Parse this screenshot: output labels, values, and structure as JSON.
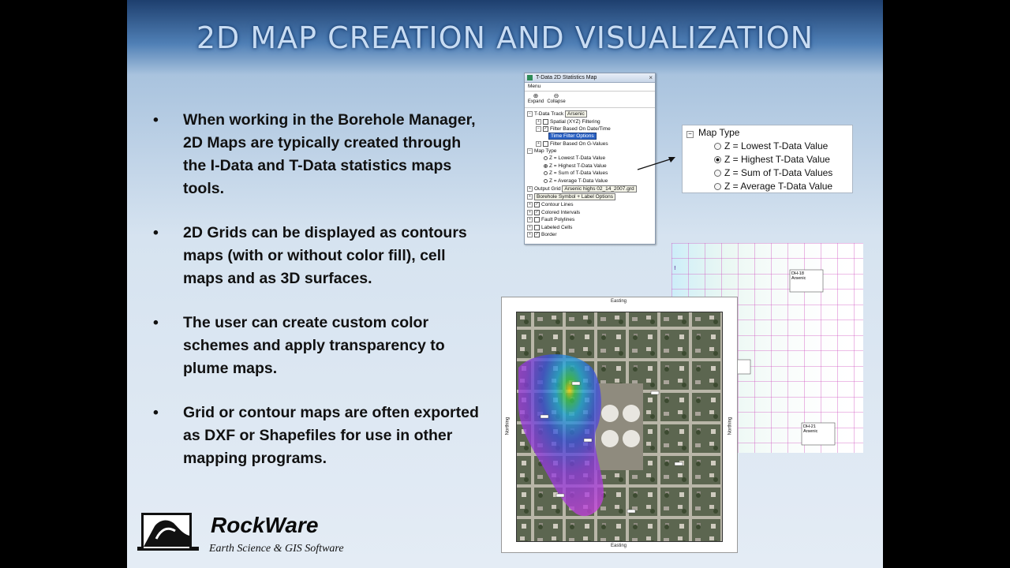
{
  "slide": {
    "title": "2D MAP CREATION AND VISUALIZATION",
    "bullet_char": "•",
    "bullets": [
      "When working in the Borehole Manager, 2D Maps are typically created through the I-Data and T-Data statistics maps tools.",
      "2D Grids can be displayed as contours maps (with or without color fill), cell maps and as 3D surfaces.",
      "The user can create custom color schemes and apply transparency to plume maps.",
      "Grid or contour maps are often exported as DXF or Shapefiles for use in other  mapping programs."
    ]
  },
  "dialog": {
    "title": "T-Data 2D Statistics Map",
    "menu": "Menu",
    "expand": "Expand",
    "collapse": "Collapse",
    "tdata_track": "T-Data Track",
    "tdata_track_value": "Arsenic",
    "spatial_filtering": "Spatial (XYZ) Filtering",
    "filter_date": "Filter Based On Date/Time",
    "time_filter_options": "Time Filter Options",
    "filter_gvalues": "Filter Based On G-Values",
    "map_type": "Map Type",
    "z_lowest": "Z = Lowest T-Data Value",
    "z_highest": "Z = Highest T-Data Value",
    "z_sum": "Z = Sum of T-Data Values",
    "z_average": "Z = Average T-Data Value",
    "output_grid": "Output Grid",
    "output_grid_value": "Arsenic highs 02_14_2007.grd",
    "borehole_symbol": "Borehole Symbol + Label Options",
    "contour_lines": "Contour Lines",
    "colored_intervals": "Colored Intervals",
    "fault_polylines": "Fault Polylines",
    "labeled_cells": "Labeled Cells",
    "border": "Border"
  },
  "map_type_panel": {
    "heading": "Map Type",
    "options": [
      {
        "label": "Z = Lowest T-Data Value",
        "selected": false
      },
      {
        "label": "Z = Highest T-Data Value",
        "selected": true
      },
      {
        "label": "Z = Sum of T-Data Values",
        "selected": false
      },
      {
        "label": "Z = Average T-Data Value",
        "selected": false
      }
    ]
  },
  "map": {
    "easting": "Easting",
    "northing": "Northing"
  },
  "cell_map": {
    "bh1_name": "DH-18",
    "bh1_analyte": "Arsenic",
    "bh2_name": "DH-21",
    "bh2_analyte": "Arsenic"
  },
  "brand": {
    "name": "RockWare",
    "tagline": "Earth Science & GIS Software"
  },
  "colors": {
    "title_glow": "#3a6fb0",
    "highlight": "#2b62c4",
    "grid_lines": "#d050c0"
  }
}
